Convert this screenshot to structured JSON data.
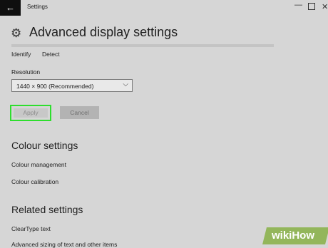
{
  "window": {
    "title": "Settings",
    "back_glyph": "←",
    "minimize_glyph": "—",
    "close_glyph": "✕"
  },
  "page": {
    "title": "Advanced display settings",
    "title_icon": "gear-icon",
    "gear_glyph": "⚙"
  },
  "display_links": {
    "identify": "Identify",
    "detect": "Detect"
  },
  "resolution": {
    "label": "Resolution",
    "value": "1440 × 900 (Recommended)",
    "chevron_glyph": "⌵"
  },
  "buttons": {
    "apply": "Apply",
    "cancel": "Cancel",
    "highlight_color": "#2ede2e"
  },
  "colour_settings": {
    "heading": "Colour settings",
    "items": [
      "Colour management",
      "Colour calibration"
    ]
  },
  "related_settings": {
    "heading": "Related settings",
    "items": [
      "ClearType text",
      "Advanced sizing of text and other items"
    ]
  },
  "watermark": {
    "text": "wikiHow",
    "color": "#93b65b"
  }
}
